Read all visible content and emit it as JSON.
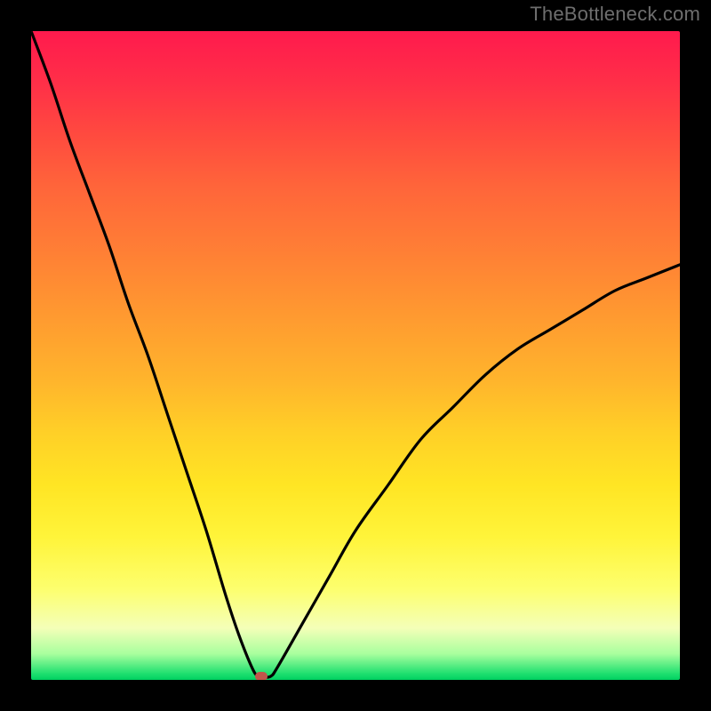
{
  "watermark": "TheBottleneck.com",
  "colors": {
    "page_bg": "#000000",
    "curve": "#000000",
    "marker": "#c1554b"
  },
  "chart_data": {
    "type": "line",
    "title": "",
    "xlabel": "",
    "ylabel": "",
    "xlim": [
      0,
      100
    ],
    "ylim": [
      0,
      100
    ],
    "grid": false,
    "annotations": [
      "TheBottleneck.com"
    ],
    "series": [
      {
        "name": "bottleneck-curve",
        "x": [
          0,
          3,
          6,
          9,
          12,
          15,
          18,
          21,
          24,
          27,
          30,
          32,
          34,
          35,
          36,
          37,
          38,
          42,
          46,
          50,
          55,
          60,
          65,
          70,
          75,
          80,
          85,
          90,
          95,
          100
        ],
        "y": [
          100,
          92,
          83,
          75,
          67,
          58,
          50,
          41,
          32,
          23,
          13,
          7,
          2,
          0.5,
          0.4,
          0.6,
          2,
          9,
          16,
          23,
          30,
          37,
          42,
          47,
          51,
          54,
          57,
          60,
          62,
          64
        ]
      }
    ],
    "marker": {
      "x": 35.5,
      "y": 0.5
    }
  }
}
